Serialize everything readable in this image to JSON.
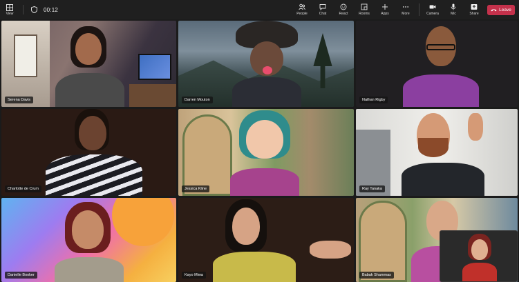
{
  "toolbar": {
    "view_label": "View",
    "timer": "00:12",
    "tools": [
      {
        "label": "People",
        "icon": "people-icon"
      },
      {
        "label": "Chat",
        "icon": "chat-icon"
      },
      {
        "label": "React",
        "icon": "react-icon"
      },
      {
        "label": "Rooms",
        "icon": "rooms-icon"
      },
      {
        "label": "Apps",
        "icon": "apps-icon"
      },
      {
        "label": "More",
        "icon": "more-icon"
      },
      {
        "label": "Camera",
        "icon": "camera-icon"
      },
      {
        "label": "Mic",
        "icon": "mic-icon"
      },
      {
        "label": "Share",
        "icon": "share-icon"
      }
    ],
    "leave_label": "Leave"
  },
  "participants": [
    {
      "name": "Serena Davis"
    },
    {
      "name": "Darren Mouton"
    },
    {
      "name": "Nathan Rigby"
    },
    {
      "name": "Charlotte de Crum"
    },
    {
      "name": "Jessica Kline"
    },
    {
      "name": "Ray Tanaka"
    },
    {
      "name": "Danielle Booker"
    },
    {
      "name": "Kayo Miwa"
    },
    {
      "name": "Babak Shammas"
    }
  ],
  "colors": {
    "leave": "#c4314b",
    "toolbar_bg": "#1f1f1f",
    "app_bg": "#1b1b1b"
  }
}
